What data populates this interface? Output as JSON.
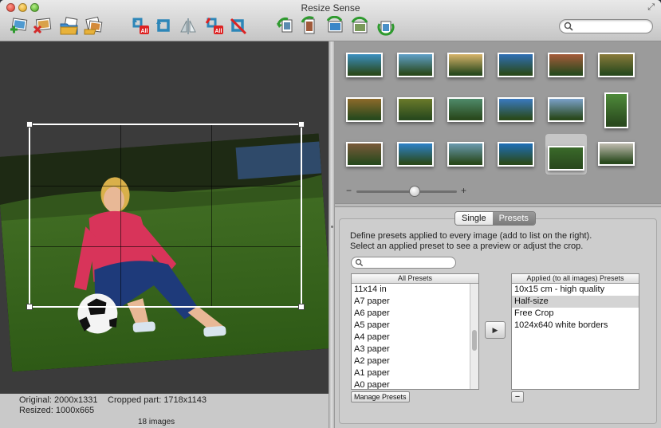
{
  "window": {
    "title": "Resize Sense"
  },
  "toolbar": {
    "left_icons": [
      "add-image-icon",
      "remove-image-icon",
      "open-folder-icon",
      "batch-images-icon"
    ],
    "middle_icons": [
      "rotate-all-left-icon",
      "rotate-left-icon",
      "flip-icon",
      "rotate-all-right-icon",
      "rotate-right-icon"
    ],
    "right_icons": [
      "go-back-icon",
      "save-icon",
      "export-icon",
      "export-all-icon",
      "convert-icon"
    ],
    "search_placeholder": ""
  },
  "preview": {
    "original": "Original: 2000x1331",
    "cropped": "Cropped part: 1718x1143",
    "resized": "Resized: 1000x665",
    "image_count": "18 images"
  },
  "thumbnails": {
    "selected_index": 16,
    "items": [
      {
        "name": "thumb-beach-resort",
        "color": "#3b8fc0"
      },
      {
        "name": "thumb-windmill",
        "color": "#5fa0c8"
      },
      {
        "name": "thumb-desert",
        "color": "#d7b46a"
      },
      {
        "name": "thumb-lake-blue",
        "color": "#2f6fb5"
      },
      {
        "name": "thumb-autumn-lake",
        "color": "#a65b3a"
      },
      {
        "name": "thumb-lion",
        "color": "#8a7a3a"
      },
      {
        "name": "thumb-tiger",
        "color": "#8c6a2a"
      },
      {
        "name": "thumb-deer",
        "color": "#6a7a2a"
      },
      {
        "name": "thumb-river-valley",
        "color": "#4f8a6a"
      },
      {
        "name": "thumb-boats",
        "color": "#3a7ac0"
      },
      {
        "name": "thumb-castle",
        "color": "#7aa0c8"
      },
      {
        "name": "thumb-golfer",
        "color": "#4e8a3a"
      },
      {
        "name": "thumb-kangaroo",
        "color": "#7a5a3a"
      },
      {
        "name": "thumb-giraffe",
        "color": "#2e82c8"
      },
      {
        "name": "thumb-flamingo",
        "color": "#6a9ab0"
      },
      {
        "name": "thumb-ocean",
        "color": "#1e6fb8"
      },
      {
        "name": "thumb-girl-football",
        "color": "#3a6a2a"
      },
      {
        "name": "thumb-village",
        "color": "#c0bcb0"
      }
    ],
    "zoom_level": 0.58
  },
  "presets": {
    "tabs": {
      "single": "Single",
      "presets": "Presets"
    },
    "description_line1": "Define presets applied to every image (add to list on the right).",
    "description_line2": "Select an applied preset to see a preview or adjust the crop.",
    "filter_placeholder": "",
    "all_header": "All Presets",
    "all_items": [
      "11x14 in",
      "A7 paper",
      "A6 paper",
      "A5 paper",
      "A4 paper",
      "A3 paper",
      "A2 paper",
      "A1 paper",
      "A0 paper"
    ],
    "applied_header": "Applied (to all images) Presets",
    "applied_items": [
      "10x15 cm - high quality",
      "Half-size",
      "Free Crop",
      "1024x640 white borders"
    ],
    "applied_selected": 1,
    "add_button": "▶",
    "manage_button": "Manage Presets",
    "remove_button": "−"
  }
}
